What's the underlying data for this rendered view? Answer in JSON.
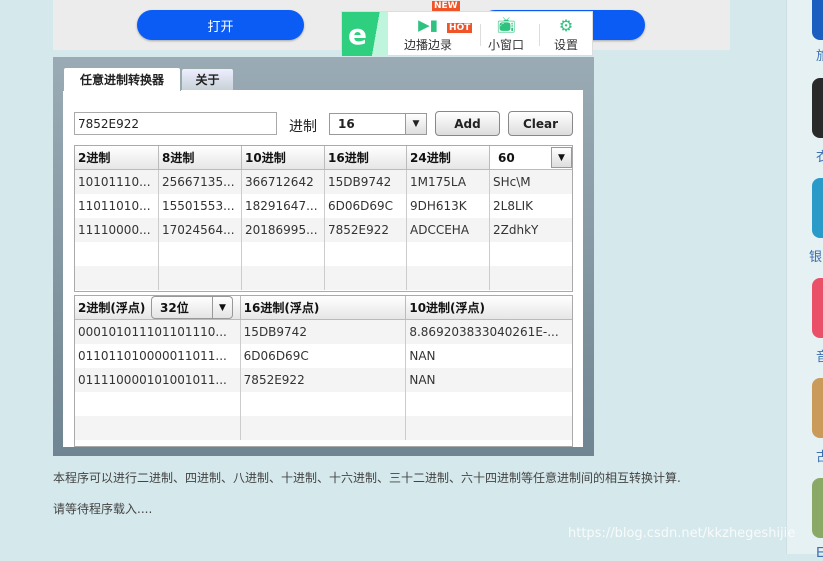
{
  "top": {
    "open_button": "打开"
  },
  "popup": {
    "items": [
      {
        "label": "边播边录",
        "icon": "video-record-icon",
        "badge_new": "NEW",
        "badge_hot": "HOT"
      },
      {
        "label": "小窗口",
        "icon": "tv-icon"
      },
      {
        "label": "设置",
        "icon": "gear-icon"
      }
    ],
    "logo": "e"
  },
  "app": {
    "tabs": [
      {
        "label": "任意进制转换器"
      },
      {
        "label": "关于"
      }
    ],
    "input_value": "7852E922",
    "base_label": "进制",
    "base_select": "16",
    "add_label": "Add",
    "clear_label": "Clear",
    "table1": {
      "headers": [
        "2进制",
        "8进制",
        "10进制",
        "16进制",
        "24进制"
      ],
      "custom_base": "60",
      "rows": [
        [
          "10101110...",
          "25667135...",
          "366712642",
          "15DB9742",
          "1M175LA",
          "SHc\\M"
        ],
        [
          "11011010...",
          "15501553...",
          "18291647...",
          "6D06D69C",
          "9DH613K",
          "2L8LIK"
        ],
        [
          "11110000...",
          "17024564...",
          "20186995...",
          "7852E922",
          "ADCCEHA",
          "2ZdhkY"
        ]
      ]
    },
    "table2": {
      "headers": [
        "2进制(浮点)",
        "16进制(浮点)",
        "10进制(浮点)"
      ],
      "bits_select": "32位",
      "rows": [
        [
          "000101011101101110...",
          "15DB9742",
          "8.869203833040261E-..."
        ],
        [
          "011011010000011011...",
          "6D06D69C",
          "NAN"
        ],
        [
          "011110000101001011...",
          "7852E922",
          "NAN"
        ]
      ]
    }
  },
  "description": "本程序可以进行二进制、四进制、八进制、十进制、十六进制、三十二进制、六十四进制等任意进制间的相互转换计算.",
  "loading": "请等待程序载入....",
  "watermark": "https://blog.csdn.net/kkzhegeshijie",
  "sidebar": {
    "labels": [
      "旅",
      "衣",
      "银",
      "音",
      "古",
      "ES"
    ]
  }
}
